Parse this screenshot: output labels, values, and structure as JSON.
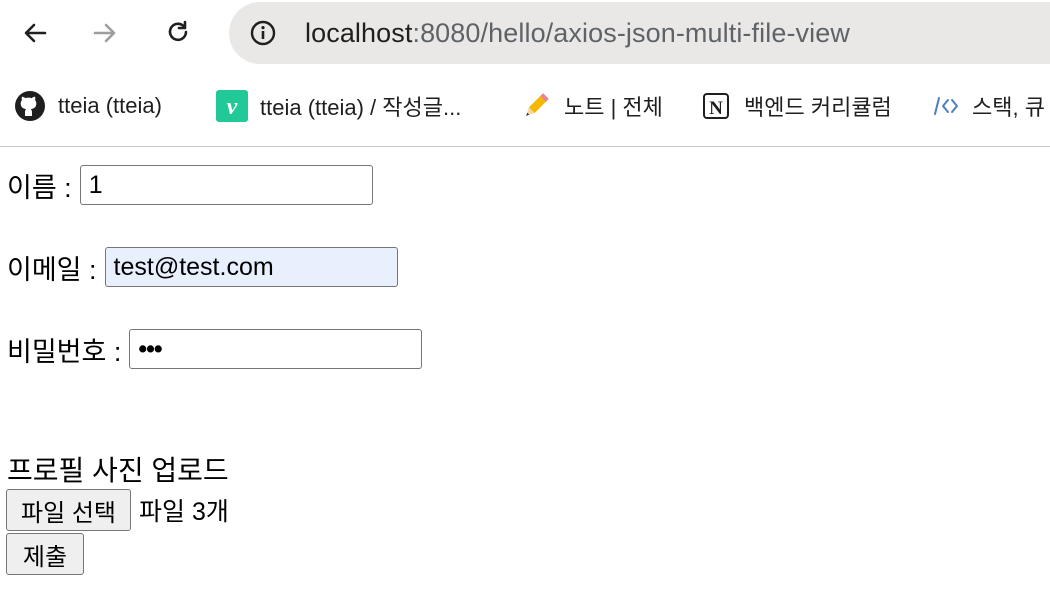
{
  "browser": {
    "url_host": "localhost",
    "url_rest": ":8080/hello/axios-json-multi-file-view",
    "icons": [
      "back-arrow-icon",
      "forward-arrow-icon",
      "reload-icon",
      "site-info-icon"
    ]
  },
  "bookmarks": [
    {
      "label": "tteia (tteia)",
      "icon": "github-icon"
    },
    {
      "label": "tteia (tteia) / 작성글...",
      "icon": "velog-icon"
    },
    {
      "label": "노트 | 전체",
      "icon": "pencil-icon"
    },
    {
      "label": "백엔드 커리큘럼",
      "icon": "notion-icon"
    },
    {
      "label": "스택, 큐",
      "icon": "code-icon"
    }
  ],
  "form": {
    "name_label": "이름 :",
    "name_value": "1",
    "email_label": "이메일 :",
    "email_value": "test@test.com",
    "password_label": "비밀번호 :",
    "password_value": "•••",
    "profile_heading": "프로필 사진 업로드",
    "file_button": "파일 선택",
    "file_status": "파일 3개",
    "submit_button": "제출"
  },
  "colors": {
    "omnibox_bg": "#e9e8e6",
    "autofill_bg": "#e8f0fe",
    "button_bg": "#efefef",
    "velog_green": "#20c997",
    "code_blue": "#4a7fc1"
  }
}
